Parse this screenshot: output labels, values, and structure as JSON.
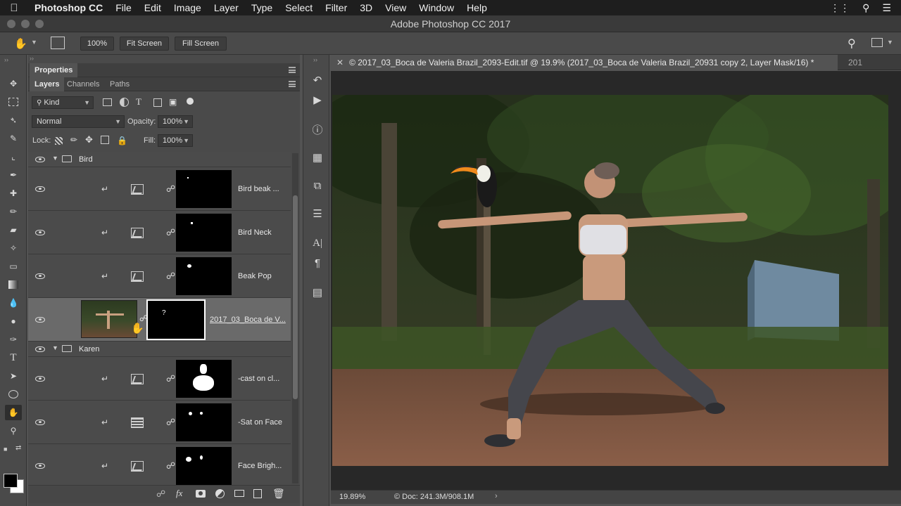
{
  "menubar": {
    "app_name": "Photoshop CC",
    "items": [
      "File",
      "Edit",
      "Image",
      "Layer",
      "Type",
      "Select",
      "Filter",
      "3D",
      "View",
      "Window",
      "Help"
    ]
  },
  "window": {
    "title": "Adobe Photoshop CC 2017"
  },
  "options": {
    "zoom": "100%",
    "fit_screen": "Fit Screen",
    "fill_screen": "Fill Screen"
  },
  "panels": {
    "properties_tab": "Properties",
    "tabs": [
      "Layers",
      "Channels",
      "Paths"
    ],
    "filter_kind": "Kind",
    "blend_mode": "Normal",
    "opacity_label": "Opacity:",
    "opacity_value": "100%",
    "lock_label": "Lock:",
    "fill_label": "Fill:",
    "fill_value": "100%"
  },
  "layers": {
    "group_bird": "Bird",
    "bird_beak": "Bird beak ...",
    "bird_neck": "Bird Neck",
    "beak_pop": "Beak Pop",
    "main_layer": "2017_03_Boca de V...",
    "group_karen": "Karen",
    "cast_on": "-cast on cl...",
    "sat_on_face": "-Sat on Face",
    "face_bright": "Face Brigh..."
  },
  "document": {
    "tab_title": "© 2017_03_Boca de Valeria Brazil_2093-Edit.tif @ 19.9% (2017_03_Boca de Valeria Brazil_20931 copy 2, Layer Mask/16) *",
    "tab_overflow": "201",
    "zoom_readout": "19.89%",
    "doc_size": "© Doc: 241.3M/908.1M"
  }
}
